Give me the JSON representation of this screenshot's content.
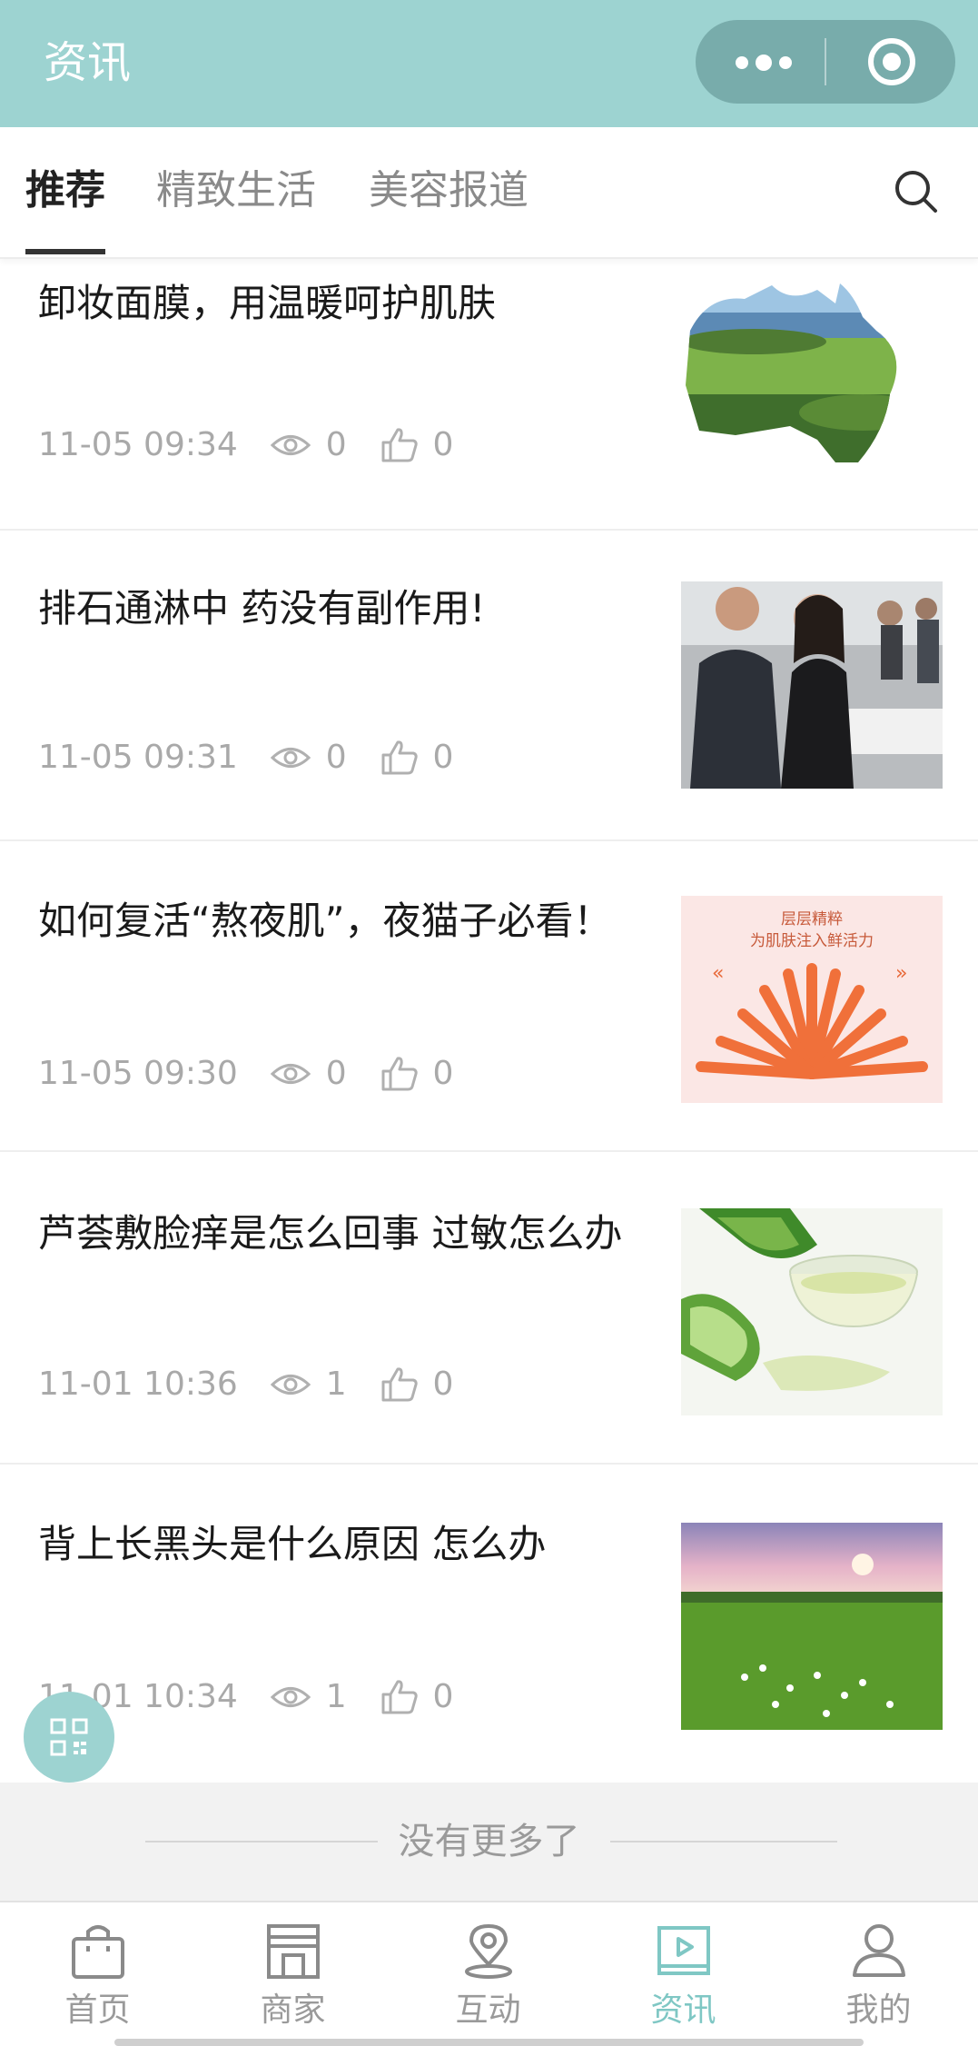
{
  "app": {
    "title": "资讯",
    "accent_color": "#9dd3d1",
    "capsule": {
      "more_icon": "more-dots-icon",
      "close_icon": "target-close-icon"
    }
  },
  "tabs": {
    "items": [
      {
        "label": "推荐",
        "active": true
      },
      {
        "label": "精致生活",
        "active": false
      },
      {
        "label": "美容报道",
        "active": false
      }
    ],
    "search_icon": "search-icon"
  },
  "news": [
    {
      "title": "卸妆面膜，用温暖呵护肌肤",
      "date": "11-05 09:34",
      "views": "0",
      "likes": "0",
      "image": "australia-landscape-map"
    },
    {
      "title": "排石通淋中 药没有副作用!",
      "date": "11-05 09:31",
      "views": "0",
      "likes": "0",
      "image": "office-people-photo"
    },
    {
      "title": "如何复活“熬夜肌”，夜猫子必看！",
      "date": "11-05 09:30",
      "views": "0",
      "likes": "0",
      "image": "serum-ampoules-ad",
      "image_text": [
        "层层精粹",
        "为肌肤注入鲜活力"
      ]
    },
    {
      "title": "芦荟敷脸痒是怎么回事 过敏怎么办",
      "date": "11-01 10:36",
      "views": "1",
      "likes": "0",
      "image": "aloe-vera-photo"
    },
    {
      "title": "背上长黑头是什么原因 怎么办",
      "date": "11-01 10:34",
      "views": "1",
      "likes": "0",
      "image": "green-field-sunset-photo"
    }
  ],
  "footer": {
    "no_more": "没有更多了"
  },
  "fab": {
    "icon": "qrcode-icon"
  },
  "tabbar": {
    "items": [
      {
        "label": "首页",
        "icon": "shopping-bag-icon",
        "active": false
      },
      {
        "label": "商家",
        "icon": "storefront-icon",
        "active": false
      },
      {
        "label": "互动",
        "icon": "location-pin-icon",
        "active": false
      },
      {
        "label": "资讯",
        "icon": "video-play-icon",
        "active": true
      },
      {
        "label": "我的",
        "icon": "user-icon",
        "active": false
      }
    ],
    "active_color": "#7fc7c4"
  }
}
